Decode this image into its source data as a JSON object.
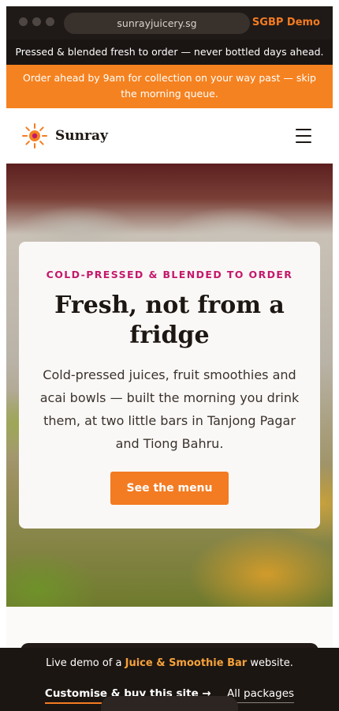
{
  "browser": {
    "url": "sunrayjuicery.sg",
    "demo_label": "SGBP Demo"
  },
  "top_strip": "Pressed & blended fresh to order — never bottled days ahead.",
  "order_banner": "Order ahead by 9am for collection on your way past — skip the morning queue.",
  "nav": {
    "brand": "Sunray",
    "logo_icon": "sun-icon",
    "menu_icon": "hamburger-icon"
  },
  "hero": {
    "eyebrow": "COLD-PRESSED & BLENDED TO ORDER",
    "headline": "Fresh, not from a fridge",
    "lede": "Cold-pressed juices, fruit smoothies and acai bowls — built the morning you drink them, at two little bars in Tanjong Pagar and Tiong Bahru.",
    "cta_label": "See the menu"
  },
  "demo_bar": {
    "text_before": "Live demo of a ",
    "highlight": "Juice & Smoothie Bar",
    "text_after": " website.",
    "buy_label": "Customise & buy this site →",
    "packages_label": "All packages"
  },
  "colors": {
    "accent": "#f37b21",
    "eyebrow": "#c4186c",
    "dark": "#1d1713"
  }
}
